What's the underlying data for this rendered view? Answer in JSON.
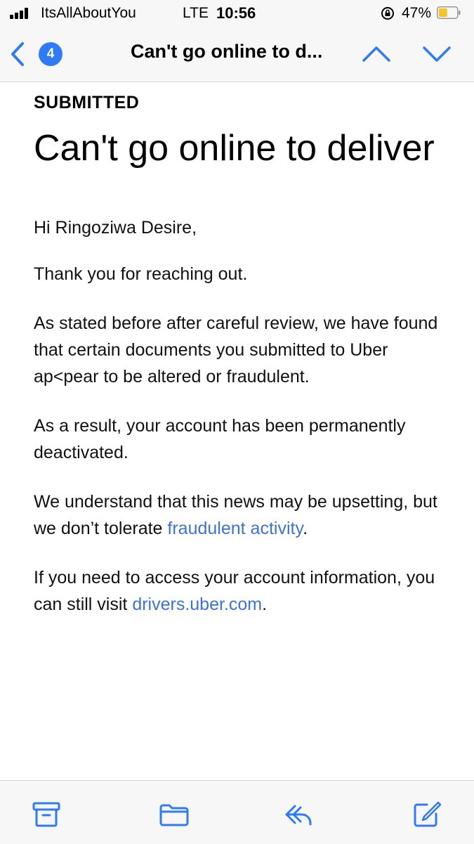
{
  "status_bar": {
    "carrier": "ItsAllAboutYou",
    "network": "LTE",
    "time": "10:56",
    "battery_percent": "47%",
    "battery_level": 0.47
  },
  "nav": {
    "unread_count": "4",
    "title": "Can't go online to d...",
    "accent_color": "#2f7bf5"
  },
  "email": {
    "status": "SUBMITTED",
    "headline": "Can't go online to deliver",
    "greeting": "Hi Ringoziwa Desire,",
    "thanks": "Thank you for reaching out.",
    "para1": "As stated before after careful review, we have found that certain documents you submitted to Uber ap<pear to be altered or fraudulent.",
    "para2": "As a result, your account has been permanently deactivated.",
    "para3_text": "We understand that this news may be upsetting, but we don’t tolerate ",
    "para3_link": "fraudulent activity",
    "para3_end": ".",
    "para4_text": "If you need to access your account information, you can still visit ",
    "para4_link": "drivers.uber.com",
    "para4_end": ".",
    "link_color": "#3d72d8"
  },
  "toolbar": {
    "icons": [
      "archive-icon",
      "folder-icon",
      "reply-icon",
      "compose-icon"
    ]
  }
}
